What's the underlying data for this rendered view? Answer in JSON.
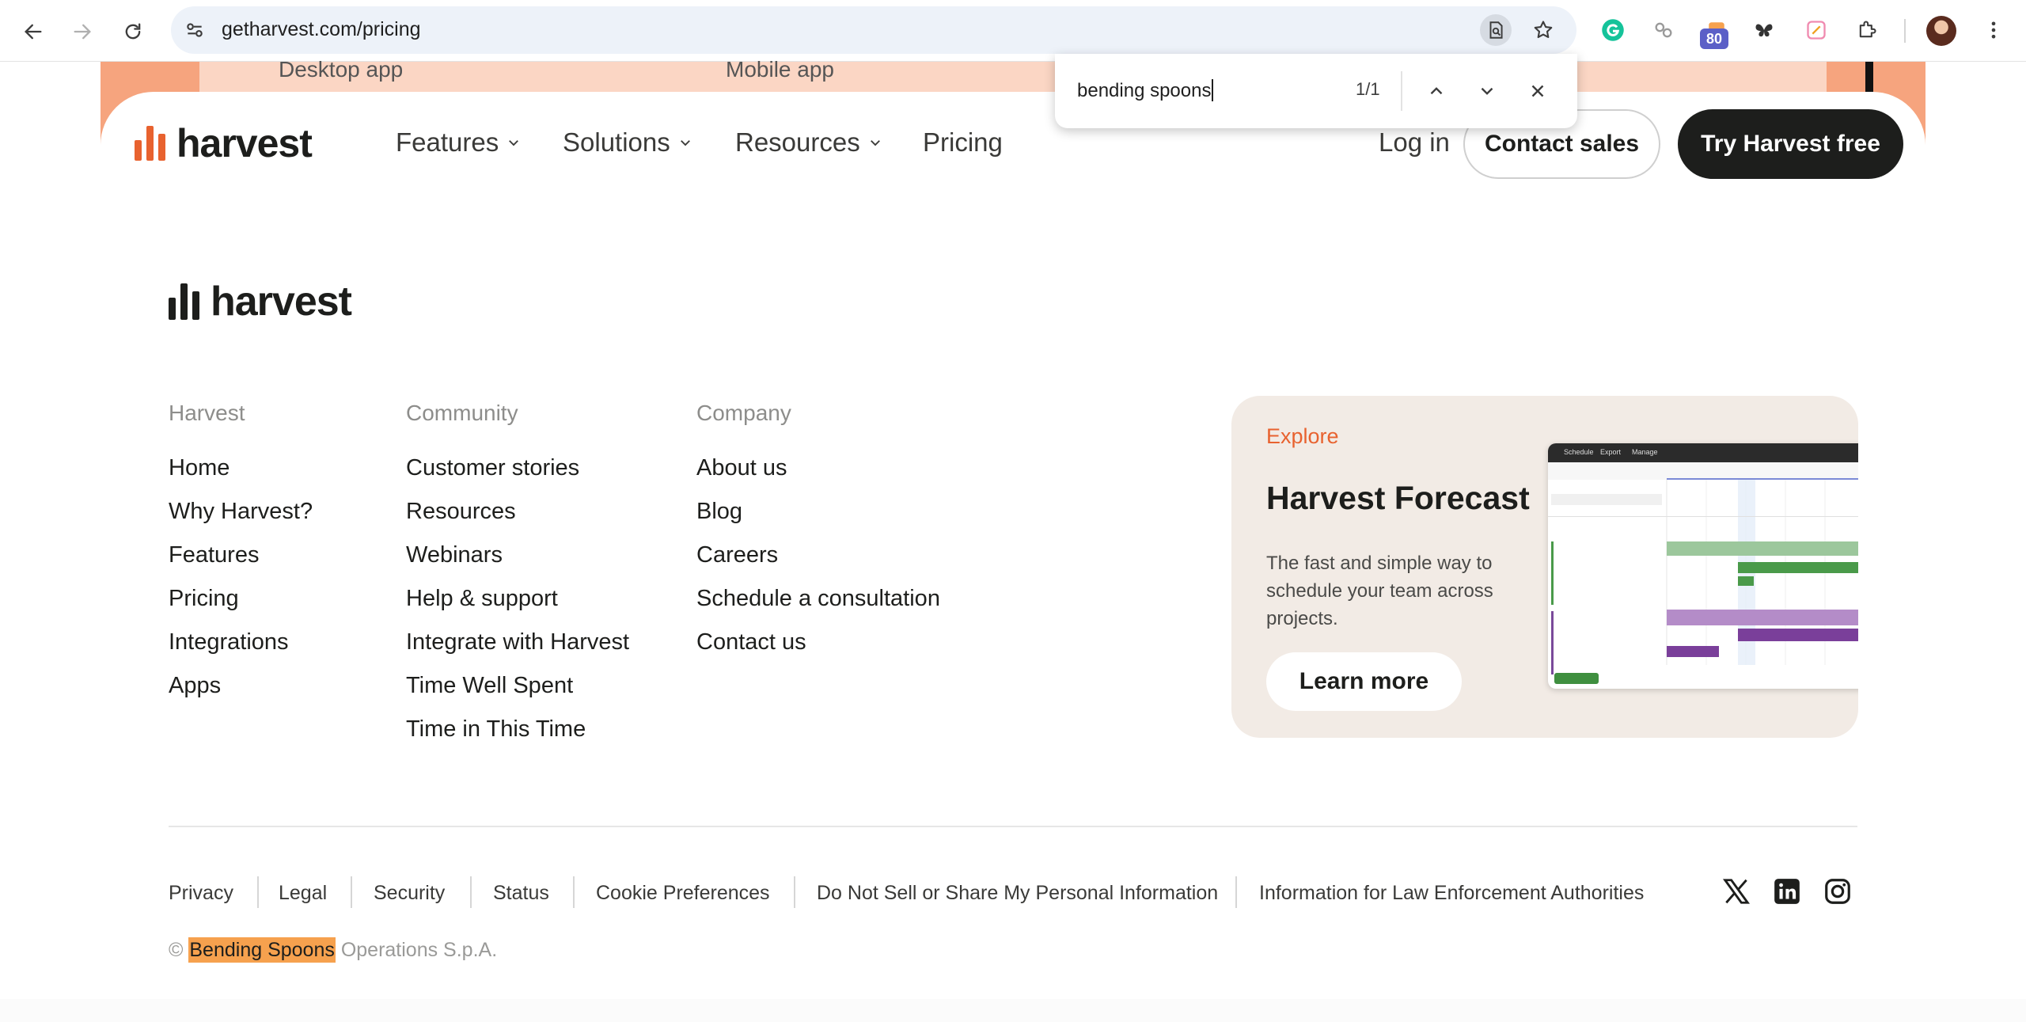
{
  "browser": {
    "url": "getharvest.com/pricing",
    "extension_badge": "80"
  },
  "find_bar": {
    "query": "bending spoons",
    "match_count": "1/1"
  },
  "header": {
    "ghost_labels": [
      "Desktop app",
      "Mobile app"
    ],
    "logo_text": "harvest",
    "nav": {
      "features": "Features",
      "solutions": "Solutions",
      "resources": "Resources",
      "pricing": "Pricing"
    },
    "login": "Log in",
    "contact_sales": "Contact sales",
    "try_free": "Try Harvest free"
  },
  "footer": {
    "logo_text": "harvest",
    "columns": [
      {
        "heading": "Harvest",
        "links": [
          "Home",
          "Why Harvest?",
          "Features",
          "Pricing",
          "Integrations",
          "Apps"
        ]
      },
      {
        "heading": "Community",
        "links": [
          "Customer stories",
          "Resources",
          "Webinars",
          "Help & support",
          "Integrate with Harvest",
          "Time Well Spent",
          "Time in This Time"
        ]
      },
      {
        "heading": "Company",
        "links": [
          "About us",
          "Blog",
          "Careers",
          "Schedule a consultation",
          "Contact us"
        ]
      }
    ],
    "promo": {
      "eyebrow": "Explore",
      "title": "Harvest Forecast",
      "description": "The fast and simple way to schedule your team across projects.",
      "cta": "Learn more",
      "mock_tabs": [
        "Schedule",
        "Export",
        "Manage"
      ]
    },
    "legal_links": [
      "Privacy",
      "Legal",
      "Security",
      "Status",
      "Cookie Preferences",
      "Do Not Sell or Share My Personal Information",
      "Information for Law Enforcement Authorities"
    ],
    "social": [
      "x-icon",
      "linkedin-icon",
      "instagram-icon"
    ],
    "copyright": {
      "prefix": "©",
      "highlight": "Bending Spoons",
      "suffix": "Operations S.p.A."
    }
  },
  "colors": {
    "brand_orange": "#e8622f",
    "header_band": "#f6a47e",
    "promo_bg": "#f2ebe5",
    "find_highlight": "#f6a14e"
  }
}
